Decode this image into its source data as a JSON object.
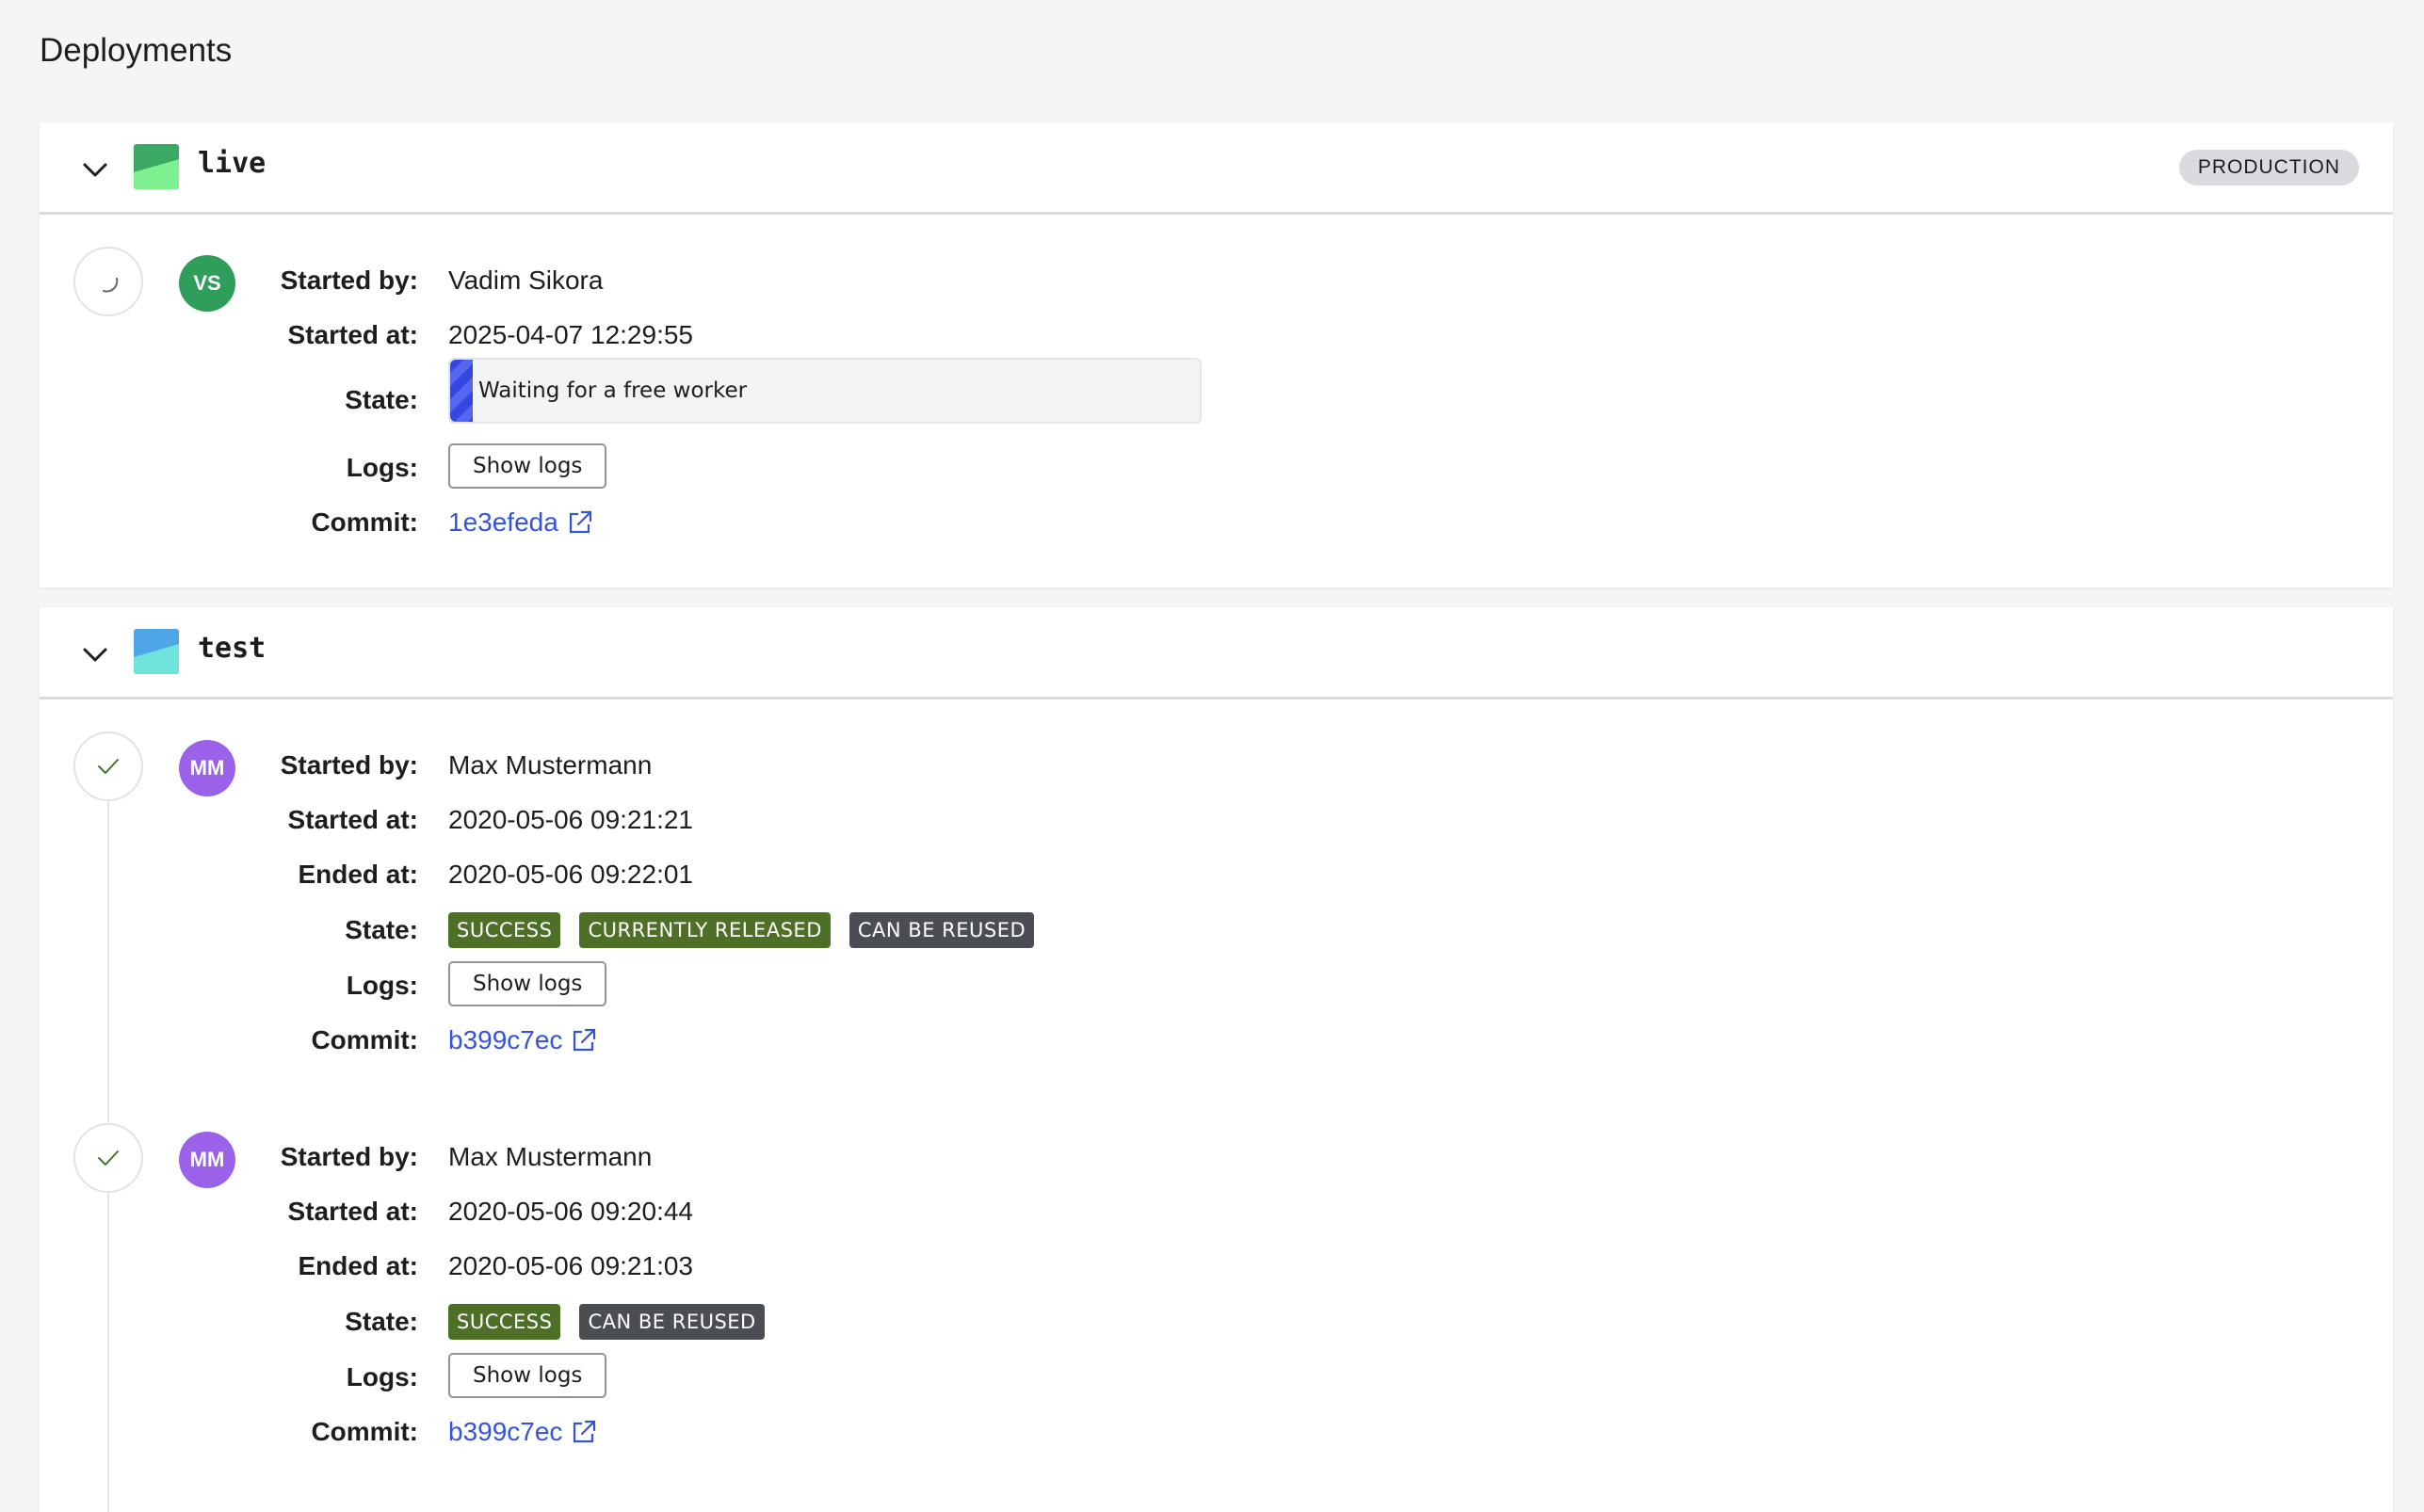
{
  "page": {
    "title": "Deployments"
  },
  "labels": {
    "started_by": "Started by:",
    "started_at": "Started at:",
    "ended_at": "Ended at:",
    "state": "State:",
    "logs": "Logs:",
    "commit": "Commit:",
    "show_logs": "Show logs"
  },
  "environments": [
    {
      "name": "live",
      "badge": "PRODUCTION",
      "icon_colors": [
        "#3aa963",
        "#7ef08f"
      ],
      "deployments": [
        {
          "status": "spinner-icon",
          "avatar": "VS",
          "avatar_color": "#2f9e5b",
          "started_by": "Vadim Sikora",
          "started_at": "2025-04-07 12:29:55",
          "state_text": "Waiting for a free worker",
          "progress": 0.03,
          "commit": "1e3efeda"
        }
      ]
    },
    {
      "name": "test",
      "badge": "",
      "icon_colors": [
        "#4fa6e6",
        "#6ee3da"
      ],
      "deployments": [
        {
          "status": "check-icon",
          "avatar": "MM",
          "avatar_color": "#9a62e8",
          "started_by": "Max Mustermann",
          "started_at": "2020-05-06 09:21:21",
          "ended_at": "2020-05-06 09:22:01",
          "badges": [
            "SUCCESS",
            "CURRENTLY RELEASED",
            "CAN BE REUSED"
          ],
          "commit": "b399c7ec"
        },
        {
          "status": "check-icon",
          "avatar": "MM",
          "avatar_color": "#9a62e8",
          "started_by": "Max Mustermann",
          "started_at": "2020-05-06 09:20:44",
          "ended_at": "2020-05-06 09:21:03",
          "badges": [
            "SUCCESS",
            "CAN BE REUSED"
          ],
          "commit": "b399c7ec"
        }
      ]
    }
  ]
}
